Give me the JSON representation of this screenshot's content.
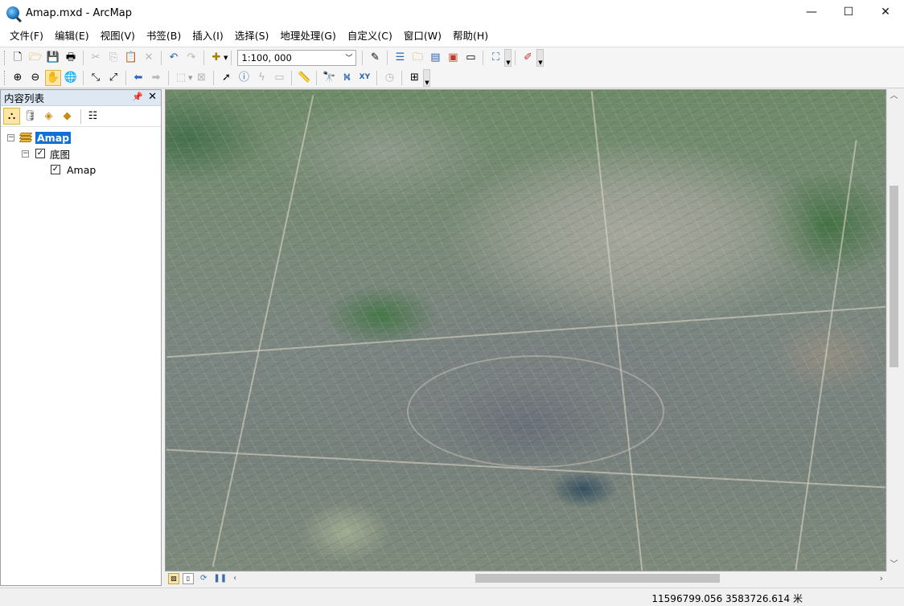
{
  "window": {
    "title": "Amap.mxd - ArcMap",
    "minimize": "—",
    "maximize": "☐",
    "close": "✕"
  },
  "menu": [
    "文件(F)",
    "编辑(E)",
    "视图(V)",
    "书签(B)",
    "插入(I)",
    "选择(S)",
    "地理处理(G)",
    "自定义(C)",
    "窗口(W)",
    "帮助(H)"
  ],
  "toolbar": {
    "scale_value": "1:100, 000",
    "standard_icons": [
      "new-document-icon",
      "open-folder-icon",
      "save-icon",
      "print-icon",
      "cut-icon",
      "copy-icon",
      "paste-icon",
      "delete-icon",
      "undo-icon",
      "redo-icon",
      "add-data-icon"
    ],
    "tools_icons": [
      "zoom-in-icon",
      "zoom-out-icon",
      "pan-icon",
      "full-extent-icon",
      "fixed-zoom-in-icon",
      "fixed-zoom-out-icon",
      "back-icon",
      "forward-icon",
      "select-features-icon",
      "clear-selection-icon",
      "select-elements-icon",
      "identify-icon",
      "hyperlink-icon",
      "html-popup-icon",
      "measure-icon",
      "find-icon",
      "find-route-icon",
      "go-to-xy-icon",
      "time-slider-icon",
      "magnifier-icon"
    ]
  },
  "toc": {
    "title": "内容列表",
    "pin": "ᵖ",
    "close": "✕",
    "data_frame": "Amap",
    "group_layer": "底图",
    "layer": "Amap",
    "layer_checked": true,
    "group_checked": true
  },
  "map": {
    "description_layer": "Amap satellite imagery"
  },
  "statusbar": {
    "coordinates": "11596799.056  3583726.614 米"
  },
  "colors": {
    "toc_header": "#dde8f3",
    "selection": "#0f71d6",
    "active_tool": "#fde5a3"
  }
}
